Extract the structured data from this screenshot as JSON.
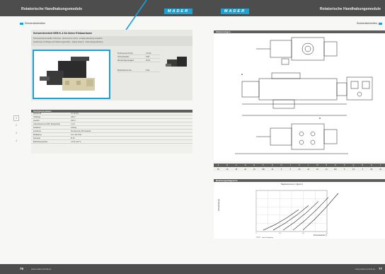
{
  "left_page": {
    "header_title": "Rotatorische Handhabungsmodule",
    "brand": "MADER",
    "section_label": "Schwenkeinheiten",
    "product_title": "Schwenkeinheit SEB K-4 für kleine Einbauräume",
    "intro_rows": [
      "Schwenkwinkelverstellbar 0-90 Grad · Drehmoment 1,6 Nm · Endlagendämpfung einstellbar",
      "Ausführung mit Abfrage durch Näherungsschalter · doppelt wirkend · Kolbenstangendichtung"
    ],
    "side_spec_rows": [
      {
        "k": "Drehmoment (6 bar)",
        "v": "1,6 Nm"
      },
      {
        "k": "Schwenkwinkel",
        "v": "0-90°"
      },
      {
        "k": "Wiederholgenauigkeit",
        "v": "±0,02"
      },
      {
        "k": "Betriebsdruck max",
        "v": "8 bar"
      }
    ],
    "tech_header": "Technische Daten",
    "tech_rows": [
      {
        "k": "Zylinder-Ø",
        "v": "2 x 12 mm"
      },
      {
        "k": "Hublänge",
        "v": "180 N"
      },
      {
        "k": "Gewicht",
        "v": "210 N"
      },
      {
        "k": "Luftverbrauch bei 180° (Doppelhub)",
        "v": "1 cm³"
      },
      {
        "k": "Schaltzeit",
        "v": "0,18 kg"
      },
      {
        "k": "Anschluss",
        "v": "Drosselventil, M3 Gewinde"
      },
      {
        "k": "Betätigung",
        "v": "0,2 s bei 6 bar"
      },
      {
        "k": "Schutzart",
        "v": "IP 64"
      },
      {
        "k": "Betriebstemperatur",
        "v": "+5 bis +60 °C"
      }
    ],
    "side_numbers": [
      "1",
      "2",
      "3",
      "4"
    ],
    "page_number": "76",
    "footer_url": "www.mader-technik.de"
  },
  "right_page": {
    "header_title": "Rotatorische Handhabungsmodule",
    "brand": "MADER",
    "section_label": "Schwenkeinheiten",
    "drawing_header": "Abmessungen",
    "dim_table": {
      "headers": [
        "A",
        "B",
        "C",
        "D",
        "E",
        "F",
        "G",
        "H",
        "J",
        "K",
        "L",
        "M",
        "N",
        "O",
        "P",
        "Q",
        "R",
        "S",
        "T"
      ],
      "values": [
        "56",
        "46",
        "35",
        "22",
        "16",
        "M5",
        "10",
        "8",
        "5",
        "30",
        "24",
        "18",
        "12",
        "M4",
        "6",
        "4,5",
        "3",
        "60",
        "40"
      ]
    },
    "chart_header": "Belastungsdiagramm",
    "page_number": "77",
    "footer_url": "www.mader-technik.de"
  },
  "chart_data": {
    "type": "line",
    "title": "Trägheitsmoment J [kgcm²]",
    "xlabel": "Schwenkwinkel [°]",
    "ylabel": "Schwenkzeit [s]",
    "legend": [
      "ohne Dämpfung",
      "mit Dämpfung"
    ],
    "series": [
      {
        "name": "",
        "values": [
          0.05,
          0.25,
          0.5,
          0.8
        ]
      },
      {
        "name": "",
        "values": [
          0.05,
          0.3,
          0.6,
          0.95
        ]
      },
      {
        "name": "",
        "values": [
          0.05,
          0.35,
          0.7,
          1.1
        ]
      },
      {
        "name": "",
        "values": [
          0.05,
          0.4,
          0.8,
          1.25
        ]
      },
      {
        "name": "",
        "values": [
          0.05,
          0.45,
          0.9,
          1.4
        ]
      }
    ],
    "categories": [
      "0",
      "30",
      "60",
      "90"
    ]
  },
  "colors": {
    "accent": "#1aa1d6",
    "dark": "#4d4d4d"
  }
}
